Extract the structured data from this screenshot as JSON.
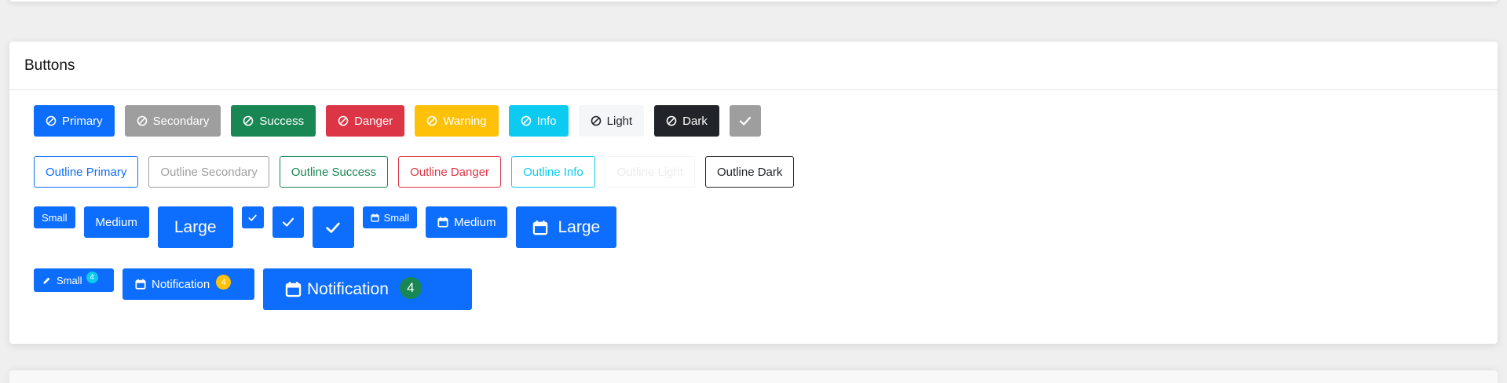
{
  "card": {
    "title": "Buttons"
  },
  "solid_buttons": [
    {
      "label": "Primary",
      "icon": "ban-icon",
      "color": "#0d6efd"
    },
    {
      "label": "Secondary",
      "icon": "ban-icon",
      "color": "#9e9e9e"
    },
    {
      "label": "Success",
      "icon": "ban-icon",
      "color": "#198754"
    },
    {
      "label": "Danger",
      "icon": "ban-icon",
      "color": "#dc3545"
    },
    {
      "label": "Warning",
      "icon": "ban-icon",
      "color": "#ffc107"
    },
    {
      "label": "Info",
      "icon": "ban-icon",
      "color": "#0dcaf0"
    },
    {
      "label": "Light",
      "icon": "ban-icon",
      "color": "#f5f6f7"
    },
    {
      "label": "Dark",
      "icon": "ban-icon",
      "color": "#212529"
    }
  ],
  "check_button": {
    "icon": "check-icon",
    "color": "#9e9e9e"
  },
  "outline_buttons": [
    {
      "label": "Outline Primary"
    },
    {
      "label": "Outline Secondary"
    },
    {
      "label": "Outline Success"
    },
    {
      "label": "Outline Danger"
    },
    {
      "label": "Outline Info"
    },
    {
      "label": "Outline Light"
    },
    {
      "label": "Outline Dark"
    }
  ],
  "size_buttons": {
    "small": "Small",
    "medium": "Medium",
    "large": "Large",
    "icon_small": "Small",
    "icon_medium": "Medium",
    "icon_large": "Large"
  },
  "notification_buttons": {
    "small": {
      "label": "Small",
      "badge": "4",
      "icon": "pencil-icon"
    },
    "medium": {
      "label": "Notification",
      "badge": "4",
      "icon": "calendar-icon"
    },
    "large": {
      "label": "Notification",
      "badge": "4",
      "icon": "calendar-icon"
    }
  }
}
